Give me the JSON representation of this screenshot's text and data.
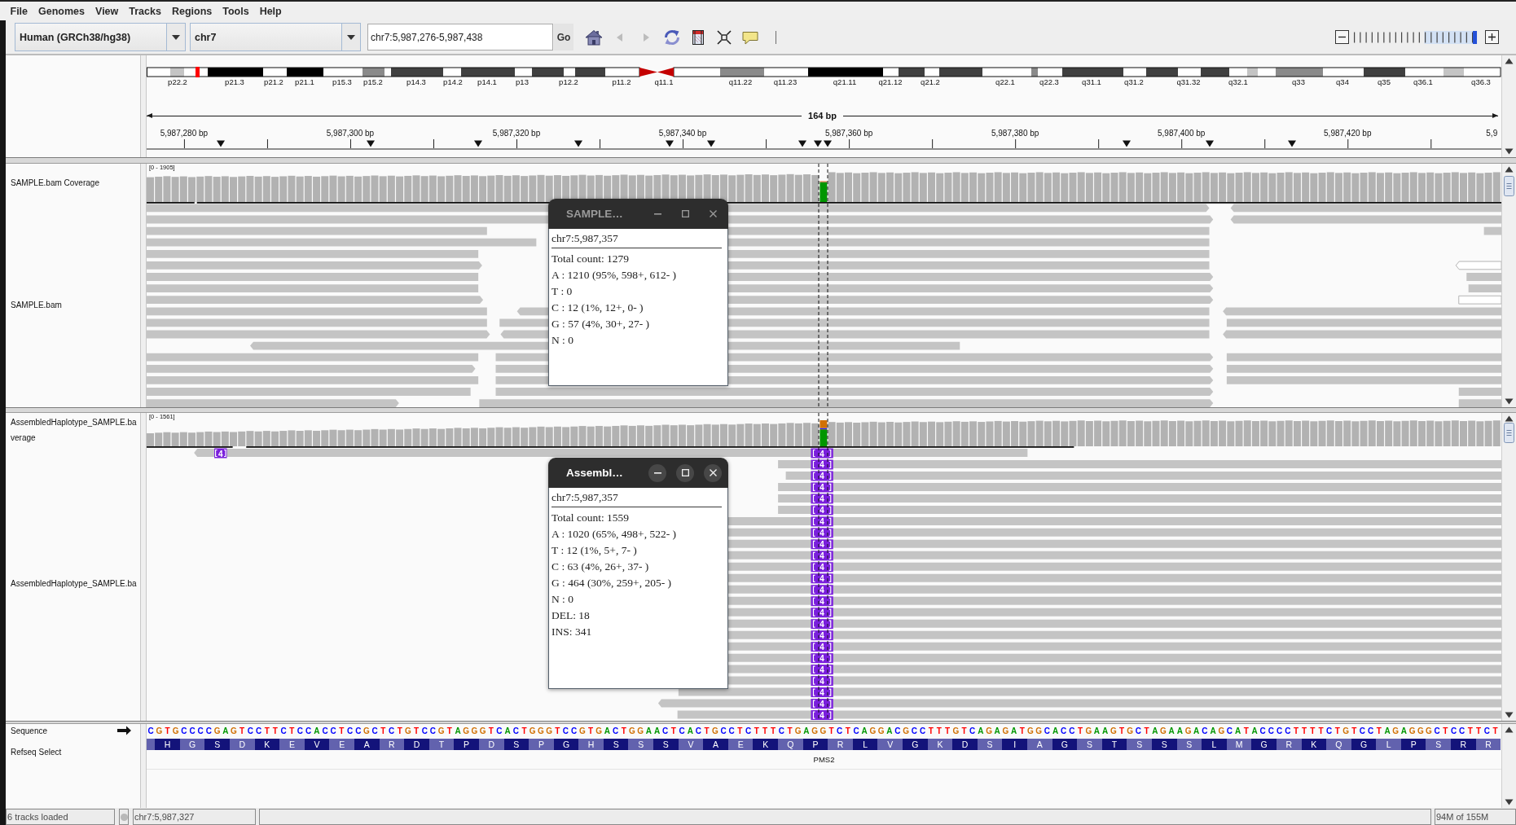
{
  "menu_bar": [
    "File",
    "Genomes",
    "View",
    "Tracks",
    "Regions",
    "Tools",
    "Help"
  ],
  "toolbar": {
    "genome": "Human (GRCh38/hg38)",
    "chromosome": "chr7",
    "locus": "chr7:5,987,276-5,987,438",
    "go_button": "Go",
    "buttons": [
      {
        "kind": "home",
        "disabled": false
      },
      {
        "kind": "back",
        "disabled": true
      },
      {
        "kind": "forward",
        "disabled": true
      },
      {
        "kind": "refresh",
        "disabled": false
      },
      {
        "kind": "region",
        "disabled": false
      },
      {
        "kind": "fit",
        "disabled": false
      },
      {
        "kind": "popup",
        "disabled": false
      }
    ],
    "zoom": {
      "level": 0.98
    }
  },
  "ideogram": {
    "band_labels": [
      "p22.2",
      "p21.3",
      "p21.2",
      "p21.1",
      "p15.3",
      "p15.2",
      "p14.3",
      "p14.2",
      "p14.1",
      "p13",
      "p12.2",
      "p11.2",
      "q11.1",
      "q11.22",
      "q11.23",
      "q21.11",
      "q21.12",
      "q21.2",
      "q22.1",
      "q22.3",
      "q31.1",
      "q31.2",
      "q31.32",
      "q32.1",
      "q33",
      "q34",
      "q35",
      "q36.1",
      "q36.3"
    ]
  },
  "ruler": {
    "span": "164 bp",
    "ticks": [
      "5,987,280 bp",
      "5,987,300 bp",
      "5,987,320 bp",
      "5,987,340 bp",
      "5,987,360 bp",
      "5,987,380 bp",
      "5,987,400 bp",
      "5,987,420 bp",
      "5,9"
    ]
  },
  "data_panels": [
    {
      "center_line": true,
      "tracks": [
        {
          "kind": "coverage",
          "name_lines": [
            "SAMPLE.bam Coverage"
          ],
          "range": "[0 - 1905]"
        },
        {
          "kind": "alignment",
          "name_lines": [
            "SAMPLE.bam"
          ]
        }
      ]
    },
    {
      "center_line": true,
      "tracks": [
        {
          "kind": "coverage",
          "name_lines": [
            "AssembledHaplotype_SAMPLE.ba",
            "verage"
          ],
          "range": "[0 - 1561]"
        },
        {
          "kind": "alignment",
          "name_lines": [
            "AssembledHaplotype_SAMPLE.ba"
          ],
          "insertions": [
            "4",
            "4",
            "4",
            "4",
            "4",
            "4",
            "4",
            "4",
            "4",
            "4",
            "4",
            "4",
            "4",
            "4",
            "4",
            "4",
            "4",
            "4",
            "4",
            "4",
            "4",
            "4",
            "4",
            "4",
            "4"
          ]
        }
      ]
    }
  ],
  "feature_panel": {
    "tracks": [
      {
        "kind": "sequence",
        "name_lines": [
          "Sequence"
        ],
        "bases": "C G T G C C C C G A G T C C T T C T C C A C C T C C G C T C T G T C C G T A G G G T C A C T G G G T C C G T G A C T G G A A C T C A C T G C C T C T T T C T G A G G T C T C A G G A C G C C T T T G T C A G A G A T G G C A C C T G A A G T G C T A G A A G A C A G C A T A C C C C T T T T C T G T C C T A G A G G G C T C C T T C T"
      },
      {
        "kind": "gene",
        "name_lines": [
          "Refseq Select"
        ],
        "amino_acids": "H G S D K E V E A R D T P D S P G H S S S V A E K Q P R L V G K D S I A G S T S S S L M G R K Q G L P S R R",
        "gene": "PMS2"
      }
    ]
  },
  "popups": [
    {
      "title": "SAMPLE…",
      "active": false,
      "locus": "chr7:5,987,357",
      "lines": [
        "Total count: 1279",
        "A : 1210 (95%, 598+, 612- )",
        "T : 0",
        "C : 12 (1%, 12+, 0- )",
        "G : 57 (4%, 30+, 27- )",
        "N : 0"
      ]
    },
    {
      "title": "Assembl…",
      "active": true,
      "locus": "chr7:5,987,357",
      "lines": [
        "Total count: 1559",
        "A : 1020 (65%, 498+, 522- )",
        "T : 12 (1%, 5+, 7- )",
        "C : 63 (4%, 26+, 37- )",
        "G : 464 (30%, 259+, 205- )",
        "N : 0",
        "DEL: 18",
        "INS: 341"
      ]
    }
  ],
  "status_bar": {
    "message": "6 tracks loaded",
    "position": "chr7:5,987,327",
    "memory": "94M of 155M"
  }
}
